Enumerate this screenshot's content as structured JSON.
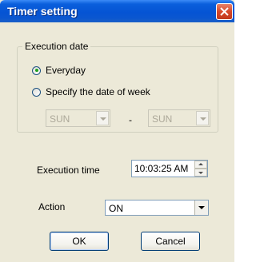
{
  "window": {
    "title": "Timer setting"
  },
  "execution_date": {
    "group_label": "Execution date",
    "options": [
      {
        "label": "Everyday",
        "checked": true
      },
      {
        "label": "Specify the date of week",
        "checked": false
      }
    ],
    "from_day": "SUN",
    "separator": "-",
    "to_day": "SUN"
  },
  "execution_time": {
    "label": "Execution time",
    "value": "10:03:25 AM"
  },
  "action": {
    "label": "Action",
    "value": "ON"
  },
  "buttons": {
    "ok": "OK",
    "cancel": "Cancel"
  },
  "colors": {
    "titlebar": "#0554d4",
    "dialog_bg": "#ece9d8",
    "close": "#d6482a"
  }
}
